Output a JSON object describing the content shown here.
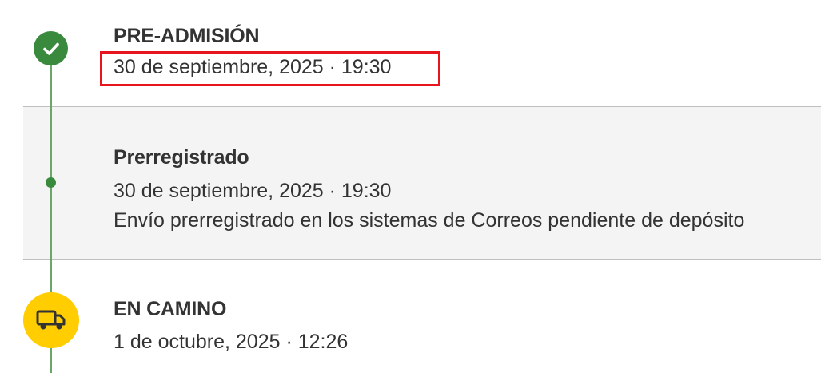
{
  "timeline": {
    "steps": [
      {
        "title": "PRE-ADMISIÓN",
        "date": "30 de septiembre, 2025 · 19:30",
        "icon": "check-icon",
        "status_color": "#3a8a3e"
      },
      {
        "title": "Prerregistrado",
        "date": "30 de septiembre, 2025 · 19:30",
        "description": "Envío prerregistrado en los sistemas de Correos pendiente de depósito",
        "icon": "dot-icon"
      },
      {
        "title": "EN CAMINO",
        "date": "1 de octubre, 2025 · 12:26",
        "icon": "truck-icon",
        "status_color": "#ffcd00"
      }
    ]
  },
  "colors": {
    "timeline_green": "#6aa66a",
    "highlight_red": "#e8141e",
    "panel_background": "#f4f4f4"
  }
}
